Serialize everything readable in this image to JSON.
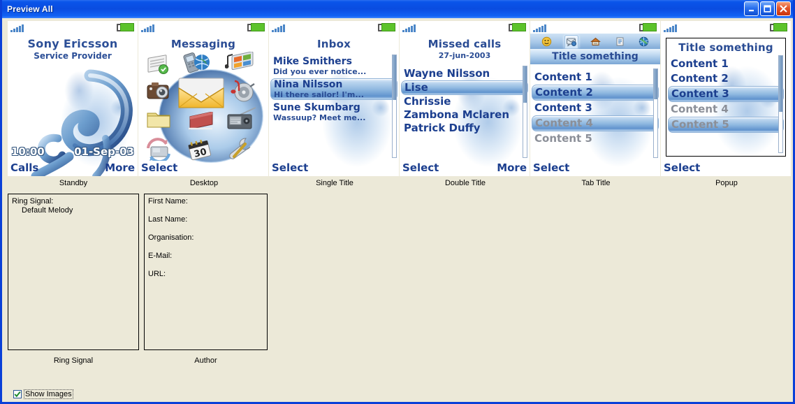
{
  "window": {
    "title": "Preview All",
    "controls": {
      "minimize": "Minimize",
      "maximize": "Maximize",
      "close": "Close"
    }
  },
  "status": {
    "signal_icon": "signal-bars-icon",
    "battery_icon": "battery-icon"
  },
  "previews": [
    {
      "label": "Standby",
      "kind": "standby",
      "title": "Sony Ericsson",
      "subtitle": "Service Provider",
      "clock": "10:00",
      "date": "01-Sep-03",
      "softkey_left": "Calls",
      "softkey_right": "More"
    },
    {
      "label": "Desktop",
      "kind": "desktop",
      "title": "Messaging",
      "softkey_left": "Select",
      "softkey_right": "",
      "icons": [
        "notes-icon",
        "phone-web-icon",
        "media-player-icon",
        "camera-icon",
        "envelope-icon",
        "music-disc-icon",
        "folder-icon",
        "book-icon",
        "radio-icon",
        "call-list-icon",
        "calendar-icon",
        "settings-wrench-icon"
      ]
    },
    {
      "label": "Single Title",
      "kind": "inbox",
      "title": "Inbox",
      "softkey_left": "Select",
      "softkey_right": "",
      "messages": [
        {
          "name": "Mike Smithers",
          "preview": "Did you ever notice...",
          "selected": false
        },
        {
          "name": "Nina Nilsson",
          "preview": "Hi there sailor! I'm...",
          "selected": true
        },
        {
          "name": "Sune Skumbarg",
          "preview": "Wassuup?  Meet me...",
          "selected": false
        }
      ]
    },
    {
      "label": "Double Title",
      "kind": "calls",
      "title": "Missed calls",
      "subtitle": "27-jun-2003",
      "softkey_left": "Select",
      "softkey_right": "More",
      "entries": [
        {
          "name": "Wayne Nilsson",
          "selected": false
        },
        {
          "name": "Lise",
          "selected": true
        },
        {
          "name": "Chrissie",
          "selected": false
        },
        {
          "name": "Zambona Mclaren",
          "selected": false
        },
        {
          "name": "Patrick Duffy",
          "selected": false
        }
      ]
    },
    {
      "label": "Tab Title",
      "kind": "tabs",
      "title": "Title something",
      "softkey_left": "Select",
      "softkey_right": "",
      "tabs": [
        {
          "icon": "contacts-icon",
          "active": false
        },
        {
          "icon": "messaging-icon",
          "active": true
        },
        {
          "icon": "mailbox-icon",
          "active": false
        },
        {
          "icon": "notes-document-icon",
          "active": false
        },
        {
          "icon": "globe-web-icon",
          "active": false
        }
      ],
      "items": [
        {
          "text": "Content 1",
          "selected": false,
          "dim": false
        },
        {
          "text": "Content 2",
          "selected": true,
          "dim": false
        },
        {
          "text": "Content 3",
          "selected": false,
          "dim": false
        },
        {
          "text": "Content 4",
          "selected": true,
          "dim": true
        },
        {
          "text": "Content 5",
          "selected": false,
          "dim": true
        }
      ]
    },
    {
      "label": "Popup",
      "kind": "popup",
      "title": "Title something",
      "softkey_left": "Select",
      "softkey_right": "",
      "items": [
        {
          "text": "Content 1",
          "selected": false,
          "dim": false
        },
        {
          "text": "Content 2",
          "selected": false,
          "dim": false
        },
        {
          "text": "Content 3",
          "selected": true,
          "dim": false
        },
        {
          "text": "Content 4",
          "selected": false,
          "dim": true
        },
        {
          "text": "Content 5",
          "selected": true,
          "dim": true
        }
      ]
    }
  ],
  "ring_signal": {
    "label": "Ring Signal",
    "field_label": "Ring Signal:",
    "value": "Default Melody"
  },
  "author": {
    "label": "Author",
    "fields": [
      "First Name:",
      "Last Name:",
      "Organisation:",
      "E-Mail:",
      "URL:"
    ]
  },
  "show_images": {
    "label": "Show Images",
    "checked": true
  }
}
